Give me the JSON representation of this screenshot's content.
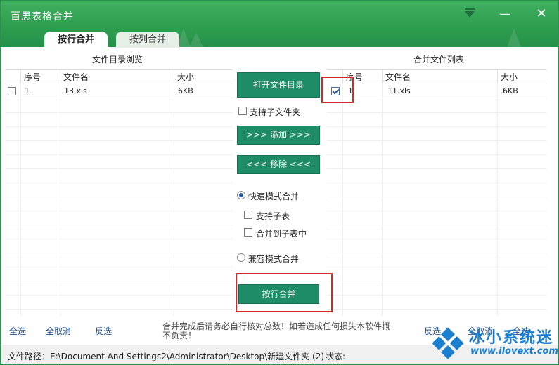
{
  "window": {
    "title": "百思表格合并"
  },
  "tabs": [
    {
      "label": "按行合并",
      "active": true
    },
    {
      "label": "按列合并",
      "active": false
    }
  ],
  "left_panel": {
    "title": "文件目录浏览",
    "columns": [
      "序号",
      "文件名",
      "大小"
    ],
    "rows": [
      {
        "checked": false,
        "index": "1",
        "name": "13.xls",
        "size": "6KB"
      }
    ]
  },
  "right_panel": {
    "title": "合并文件列表",
    "columns": [
      "序号",
      "文件名",
      "大小"
    ],
    "rows": [
      {
        "checked": true,
        "index": "1",
        "name": "11.xls",
        "size": "6KB"
      }
    ]
  },
  "controls": {
    "open_dir": "打开文件目录",
    "include_subfolders": "支持子文件夹",
    "add": ">>> 添加 >>>",
    "remove": "<<< 移除 <<<",
    "fast_mode": "快速模式合并",
    "support_subsheets": "支持子表",
    "merge_to_subsheet": "合并到子表中",
    "compat_mode": "兼容模式合并",
    "merge_button": "按行合并"
  },
  "bottom": {
    "select_all_left": "全选",
    "select_none_left": "全取消",
    "invert_left": "反选",
    "notice": "合并完成后请务必自行核对总数！如若造成任何损失本软件概不负责！",
    "invert_right": "反选",
    "select_none_right": "全取消",
    "select_all_right": "全选"
  },
  "status": {
    "path_label": "文件路径：",
    "path_value": "E:\\Document And Settings2\\Administrator\\Desktop\\新建文件夹 (2)",
    "state_label": "状态:"
  },
  "watermark": {
    "title": "冰小系统迷",
    "url": "www.ilovext.com"
  },
  "colors": {
    "titlebar": "#2e9f50",
    "button": "#1e8c67",
    "highlight": "#d9262a",
    "link": "#1a4b8c"
  }
}
